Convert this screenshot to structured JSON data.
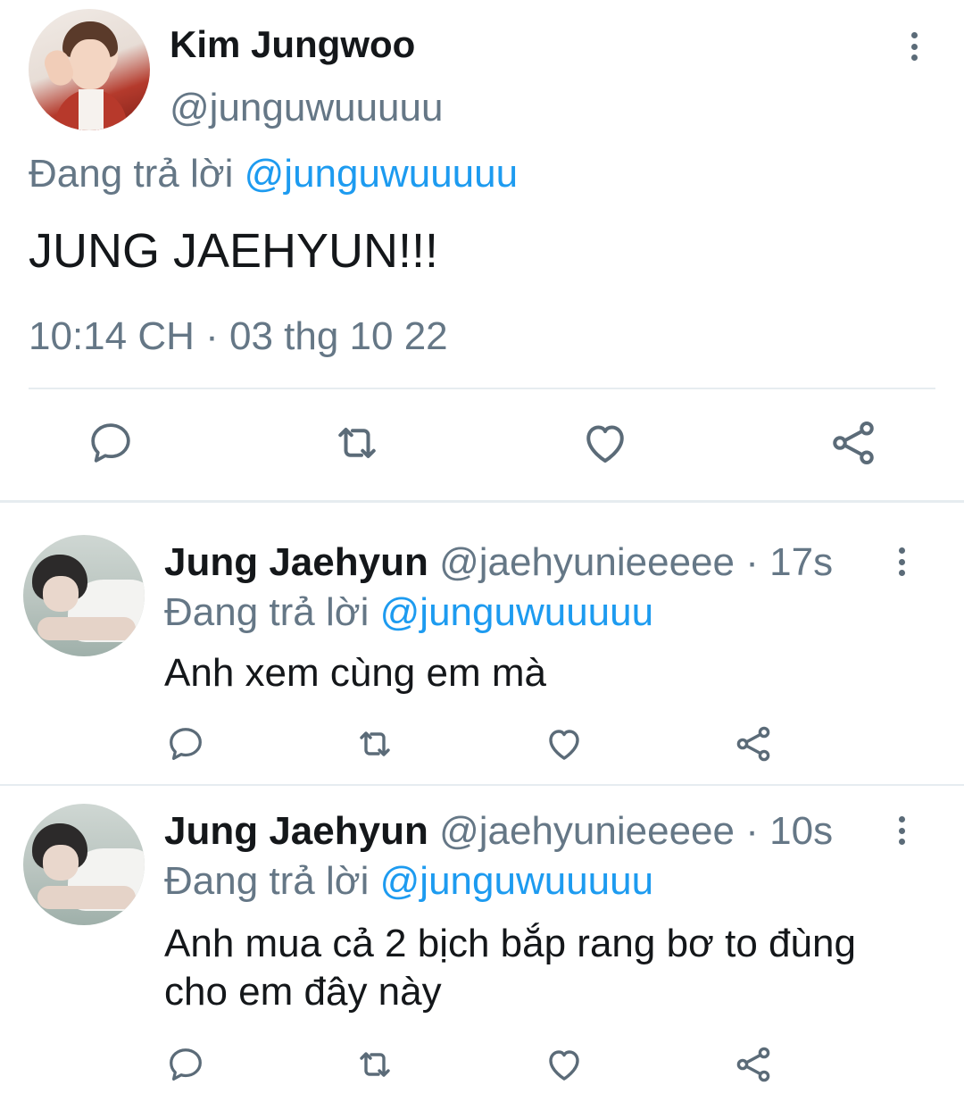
{
  "main_tweet": {
    "name": "Kim Jungwoo",
    "handle": "@junguwuuuuu",
    "replying_prefix": "Đang trả lời",
    "replying_to": "@junguwuuuuu",
    "text": "JUNG JAEHYUN!!!",
    "timestamp": "10:14 CH · 03 thg 10 22",
    "actions": [
      "reply-icon",
      "retweet-icon",
      "like-icon",
      "share-icon"
    ]
  },
  "replies": [
    {
      "name": "Jung Jaehyun",
      "handle": "@jaehyunieeeee",
      "time": "· 17s",
      "replying_prefix": "Đang trả lời",
      "replying_to": "@junguwuuuuu",
      "text": "Anh xem cùng em mà"
    },
    {
      "name": "Jung Jaehyun",
      "handle": "@jaehyunieeeee",
      "time": "· 10s",
      "replying_prefix": "Đang trả lời",
      "replying_to": "@junguwuuuuu",
      "text_line1": "Anh mua cả 2 bịch bắp rang bơ to đùng",
      "text_line2": "cho em đây này"
    }
  ],
  "colors": {
    "mention": "#1d9bf0",
    "secondary_text": "#657786",
    "primary_text": "#14171a",
    "divider": "#e6ecf0"
  }
}
